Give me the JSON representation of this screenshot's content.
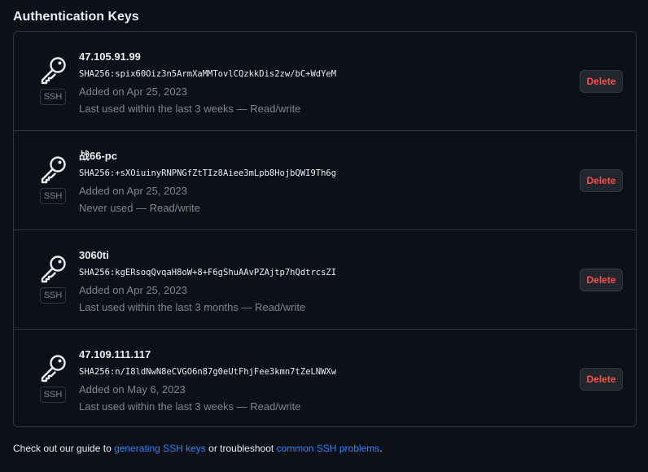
{
  "section": {
    "title": "Authentication Keys"
  },
  "keys": [
    {
      "title": "47.105.91.99",
      "fingerprint": "SHA256:spix60Oiz3n5ArmXaMMTovlCQzkkDis2zw/bC+WdYeM",
      "added": "Added on Apr 25, 2023",
      "usage": "Last used within the last 3 weeks — Read/write",
      "badge": "SSH",
      "icon": "key-icon",
      "delete_label": "Delete"
    },
    {
      "title": "战66-pc",
      "fingerprint": "SHA256:+sXOiuinyRNPNGfZtTIz8Aiee3mLpb8HojbQWI9Th6g",
      "added": "Added on Apr 25, 2023",
      "usage": "Never used — Read/write",
      "badge": "SSH",
      "icon": "key-icon",
      "delete_label": "Delete"
    },
    {
      "title": "3060ti",
      "fingerprint": "SHA256:kgERsoqQvqaH8oW+8+F6gShuAAvPZAjtp7hQdtrcsZI",
      "added": "Added on Apr 25, 2023",
      "usage": "Last used within the last 3 months — Read/write",
      "badge": "SSH",
      "icon": "key-icon",
      "delete_label": "Delete"
    },
    {
      "title": "47.109.111.117",
      "fingerprint": "SHA256:n/I8ldNwN8eCVGO6n87g0eUtFhjFee3kmn7tZeLNWXw",
      "added": "Added on May 6, 2023",
      "usage": "Last used within the last 3 weeks — Read/write",
      "badge": "SSH",
      "icon": "key-icon",
      "delete_label": "Delete"
    }
  ],
  "footer": {
    "prefix": "Check out our guide to ",
    "link1": "generating SSH keys",
    "middle": " or troubleshoot ",
    "link2": "common SSH problems",
    "suffix": "."
  },
  "colors": {
    "background": "#0d1117",
    "border": "#30363d",
    "text": "#e6edf3",
    "muted": "#7d8590",
    "danger": "#f85149",
    "link": "#2f81f7"
  }
}
